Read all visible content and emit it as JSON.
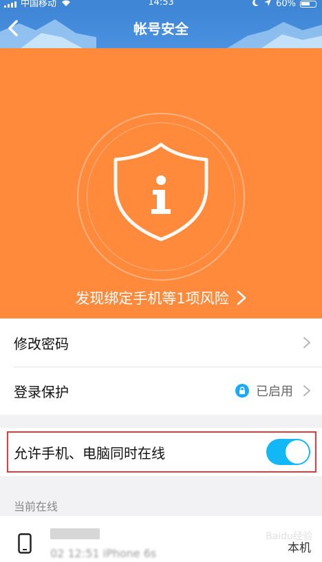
{
  "status_bar": {
    "carrier": "中国移动",
    "time": "14:53",
    "battery": "60%"
  },
  "nav": {
    "title": "帐号安全"
  },
  "hero": {
    "risk_text": "发现绑定手机等1项风险"
  },
  "settings": [
    {
      "label": "修改密码"
    },
    {
      "label": "登录保护",
      "status": "已启用"
    }
  ],
  "online_toggle": {
    "label": "允许手机、电脑同时在线",
    "enabled": true
  },
  "current_online": {
    "section_label": "当前在线",
    "device_info": "02 12:51 iPhone 6s",
    "local_label": "本机"
  },
  "watermark": "Baidu经验",
  "colors": {
    "nav_blue": "#3f86d6",
    "hero_orange": "#ff8a3c",
    "toggle_blue": "#12b7f5",
    "highlight_red": "#e43a3a"
  }
}
